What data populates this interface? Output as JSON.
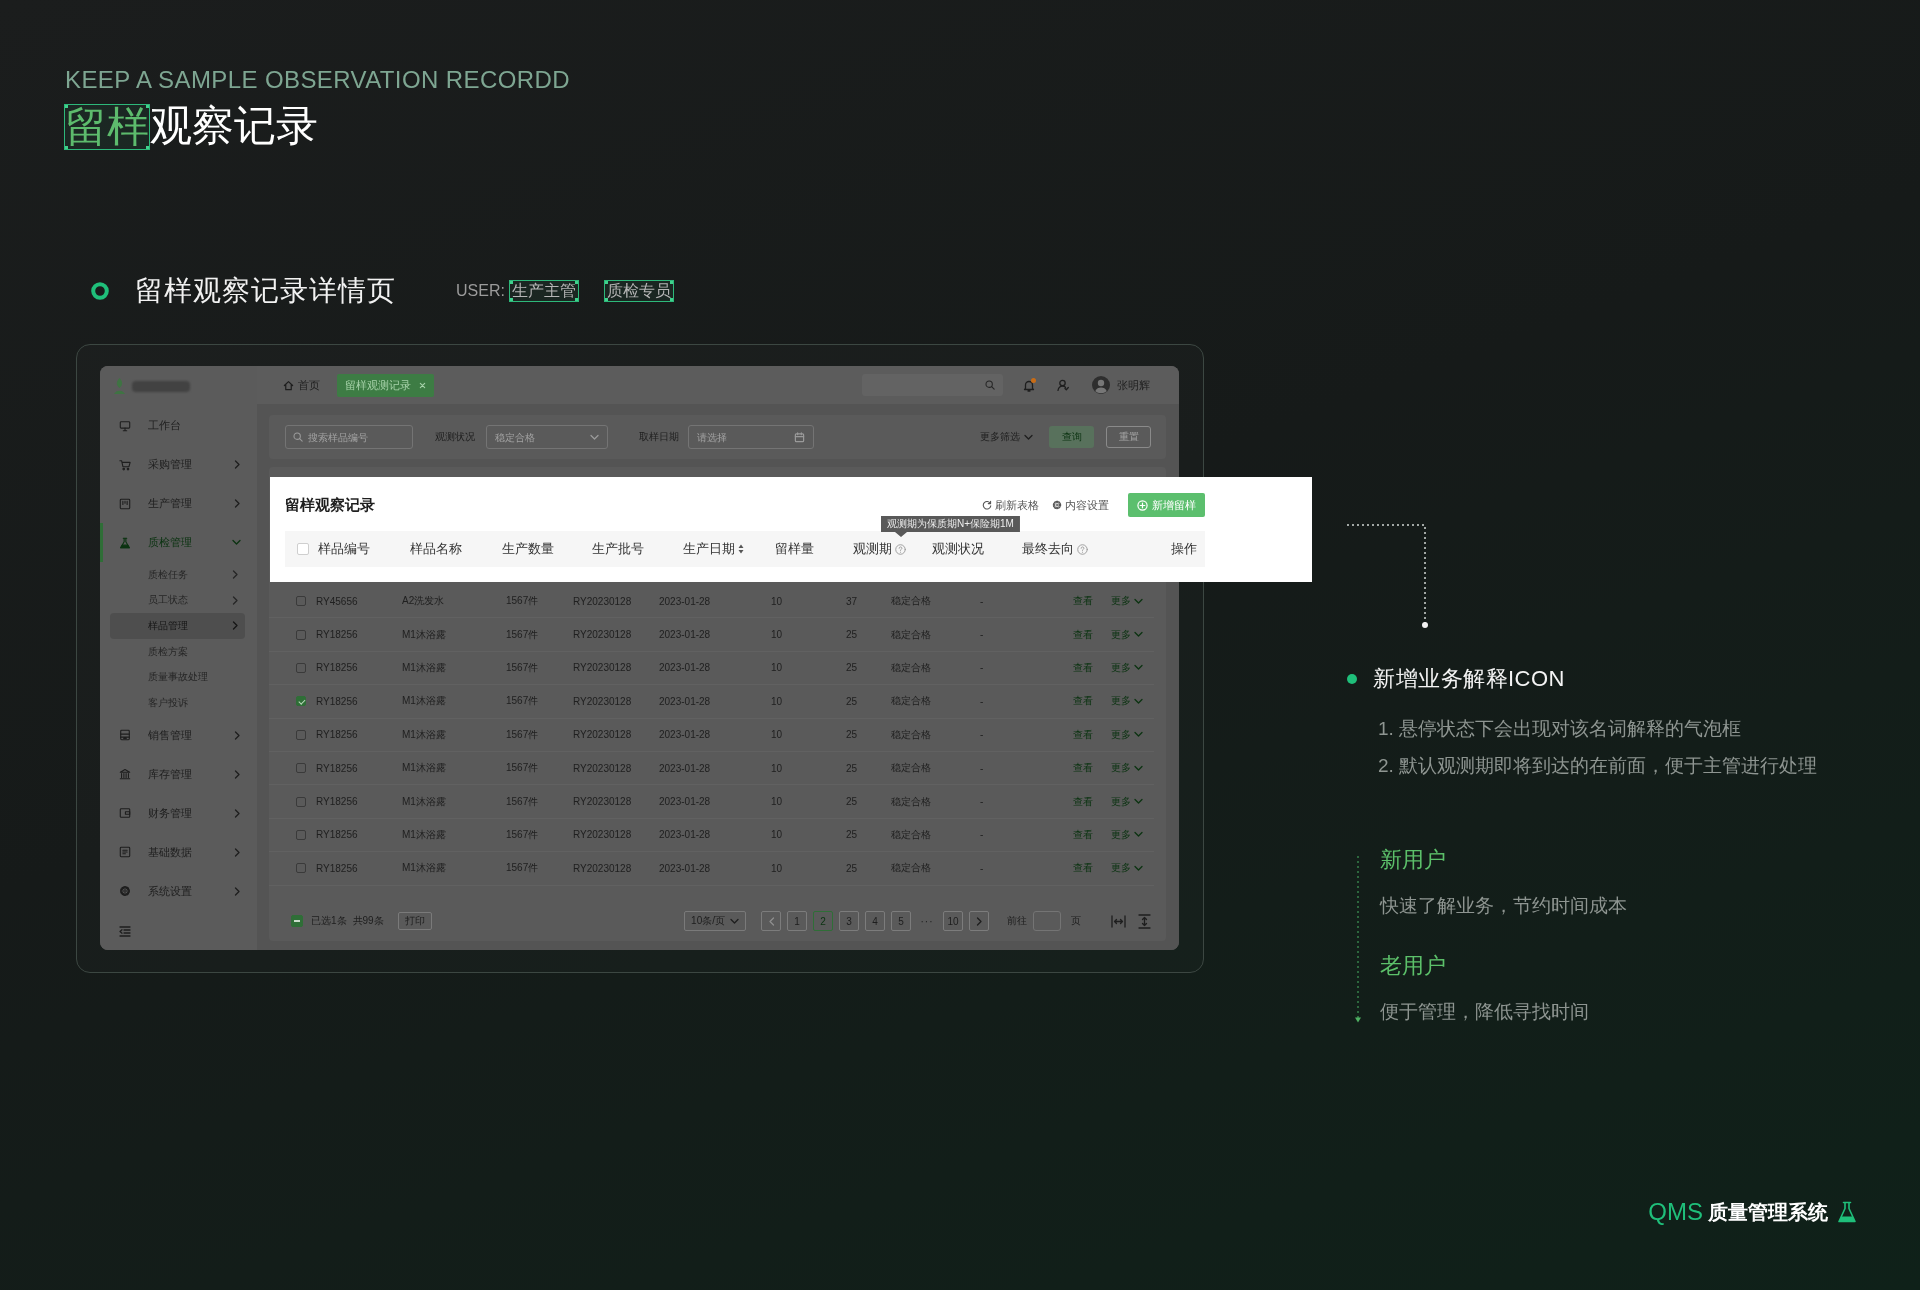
{
  "heading": {
    "subtitle": "KEEP A SAMPLE OBSERVATION RECORDD",
    "title_highlight": "留样",
    "title_rest": "观察记录"
  },
  "section": {
    "title": "留样观察记录详情页",
    "user_label": "USER:",
    "user_roles": [
      "生产主管",
      "质检专员"
    ]
  },
  "app": {
    "sidebar": {
      "items": [
        {
          "kind": "link",
          "label": "工作台",
          "selected": false
        },
        {
          "kind": "group",
          "label": "采购管理",
          "selected": false,
          "expanded": false
        },
        {
          "kind": "group",
          "label": "生产管理",
          "selected": false,
          "expanded": false
        },
        {
          "kind": "group",
          "label": "质检管理",
          "selected": true,
          "expanded": true,
          "children": [
            {
              "kind": "group",
              "label": "质检任务",
              "selected": false,
              "expanded": false
            },
            {
              "kind": "group",
              "label": "员工状态",
              "selected": false,
              "expanded": false
            },
            {
              "kind": "group",
              "label": "样品管理",
              "selected": true,
              "expanded": false
            },
            {
              "kind": "link",
              "label": "质检方案",
              "selected": false
            },
            {
              "kind": "link",
              "label": "质量事故处理",
              "selected": false
            },
            {
              "kind": "link",
              "label": "客户投诉",
              "selected": false
            }
          ]
        },
        {
          "kind": "group",
          "label": "销售管理",
          "selected": false,
          "expanded": false
        },
        {
          "kind": "group",
          "label": "库存管理",
          "selected": false,
          "expanded": false
        },
        {
          "kind": "group",
          "label": "财务管理",
          "selected": false,
          "expanded": false
        },
        {
          "kind": "group",
          "label": "基础数据",
          "selected": false,
          "expanded": false
        },
        {
          "kind": "group",
          "label": "系统设置",
          "selected": false,
          "expanded": false
        }
      ]
    },
    "topbar": {
      "tabs": [
        {
          "kind": "home",
          "label": "首页",
          "selected": false
        },
        {
          "kind": "closable",
          "label": "留样观测记录",
          "selected": true
        }
      ],
      "unread": true,
      "user_name": "张明辉"
    },
    "filters": {
      "search_placeholder": "搜索样品编号",
      "fields": [
        {
          "kind": "select",
          "label": "观测状况",
          "placeholder": "稳定合格"
        },
        {
          "kind": "date",
          "label": "取样日期",
          "placeholder": "请选择"
        }
      ],
      "more_filters": "更多筛选",
      "buttons": [
        {
          "kind": "primary",
          "label": "查询"
        },
        {
          "kind": "outline",
          "label": "重置"
        }
      ]
    },
    "table": {
      "rows": [
        {
          "checked": false,
          "cells": [
            "RY45656",
            "A2洗发水",
            "1567件",
            "RY20230128",
            "2023-01-28",
            "10",
            "37",
            "稳定合格",
            "-"
          ],
          "actions": [
            {
              "kind": "link",
              "label": "查看"
            },
            {
              "kind": "dropdown",
              "label": "更多"
            }
          ]
        },
        {
          "checked": false,
          "cells": [
            "RY18256",
            "M1沐浴露",
            "1567件",
            "RY20230128",
            "2023-01-28",
            "10",
            "25",
            "稳定合格",
            "-"
          ],
          "actions": [
            {
              "kind": "link",
              "label": "查看"
            },
            {
              "kind": "dropdown",
              "label": "更多"
            }
          ]
        },
        {
          "checked": false,
          "cells": [
            "RY18256",
            "M1沐浴露",
            "1567件",
            "RY20230128",
            "2023-01-28",
            "10",
            "25",
            "稳定合格",
            "-"
          ],
          "actions": [
            {
              "kind": "link",
              "label": "查看"
            },
            {
              "kind": "dropdown",
              "label": "更多"
            }
          ]
        },
        {
          "checked": true,
          "cells": [
            "RY18256",
            "M1沐浴露",
            "1567件",
            "RY20230128",
            "2023-01-28",
            "10",
            "25",
            "稳定合格",
            "-"
          ],
          "actions": [
            {
              "kind": "link",
              "label": "查看"
            },
            {
              "kind": "dropdown",
              "label": "更多"
            }
          ]
        },
        {
          "checked": false,
          "cells": [
            "RY18256",
            "M1沐浴露",
            "1567件",
            "RY20230128",
            "2023-01-28",
            "10",
            "25",
            "稳定合格",
            "-"
          ],
          "actions": [
            {
              "kind": "link",
              "label": "查看"
            },
            {
              "kind": "dropdown",
              "label": "更多"
            }
          ]
        },
        {
          "checked": false,
          "cells": [
            "RY18256",
            "M1沐浴露",
            "1567件",
            "RY20230128",
            "2023-01-28",
            "10",
            "25",
            "稳定合格",
            "-"
          ],
          "actions": [
            {
              "kind": "link",
              "label": "查看"
            },
            {
              "kind": "dropdown",
              "label": "更多"
            }
          ]
        },
        {
          "checked": false,
          "cells": [
            "RY18256",
            "M1沐浴露",
            "1567件",
            "RY20230128",
            "2023-01-28",
            "10",
            "25",
            "稳定合格",
            "-"
          ],
          "actions": [
            {
              "kind": "link",
              "label": "查看"
            },
            {
              "kind": "dropdown",
              "label": "更多"
            }
          ]
        },
        {
          "checked": false,
          "cells": [
            "RY18256",
            "M1沐浴露",
            "1567件",
            "RY20230128",
            "2023-01-28",
            "10",
            "25",
            "稳定合格",
            "-"
          ],
          "actions": [
            {
              "kind": "link",
              "label": "查看"
            },
            {
              "kind": "dropdown",
              "label": "更多"
            }
          ]
        },
        {
          "checked": false,
          "cells": [
            "RY18256",
            "M1沐浴露",
            "1567件",
            "RY20230128",
            "2023-01-28",
            "10",
            "25",
            "稳定合格",
            "-"
          ],
          "actions": [
            {
              "kind": "link",
              "label": "查看"
            },
            {
              "kind": "dropdown",
              "label": "更多"
            }
          ]
        }
      ]
    },
    "footer": {
      "indeterminate": true,
      "selection": "已选1条",
      "total": "共99条",
      "print": "打印",
      "page_size": "10条/页",
      "prev_disabled": true,
      "next_disabled": false,
      "pages": [
        {
          "kind": "page",
          "label": "1",
          "selected": false
        },
        {
          "kind": "page",
          "label": "2",
          "selected": true
        },
        {
          "kind": "page",
          "label": "3",
          "selected": false
        },
        {
          "kind": "page",
          "label": "4",
          "selected": false
        },
        {
          "kind": "page",
          "label": "5",
          "selected": false
        },
        {
          "kind": "ellipsis",
          "label": "···",
          "selected": false
        },
        {
          "kind": "page",
          "label": "10",
          "selected": false
        }
      ],
      "goto_label": "前往",
      "goto_unit": "页"
    }
  },
  "callout": {
    "title": "留样观察记录",
    "tools": [
      {
        "kind": "refresh",
        "label": "刷新表格"
      },
      {
        "kind": "settings",
        "label": "内容设置"
      }
    ],
    "add_button": "新增留样",
    "select_all": {
      "checked": false
    },
    "columns": [
      {
        "label": "样品编号",
        "sortable": false,
        "help": false
      },
      {
        "label": "样品名称",
        "sortable": false,
        "help": false
      },
      {
        "label": "生产数量",
        "sortable": false,
        "help": false
      },
      {
        "label": "生产批号",
        "sortable": false,
        "help": false
      },
      {
        "label": "生产日期",
        "sortable": true,
        "help": false
      },
      {
        "label": "留样量",
        "sortable": false,
        "help": false
      },
      {
        "label": "观测期",
        "sortable": false,
        "help": true,
        "tooltip": "观测期为保质期N+保险期1M"
      },
      {
        "label": "观测状况",
        "sortable": false,
        "help": false
      },
      {
        "label": "最终去向",
        "sortable": false,
        "help": true
      },
      {
        "label": "操作",
        "sortable": false,
        "help": false
      }
    ]
  },
  "notes": {
    "title": "新增业务解释ICON",
    "points": [
      "1. 悬停状态下会出现对该名词解释的气泡框",
      "2. 默认观测期即将到达的在前面，便于主管进行处理"
    ]
  },
  "user_groups": [
    {
      "title": "新用户",
      "text": "快速了解业务，节约时间成本"
    },
    {
      "title": "老用户",
      "text": "便于管理，降低寻找时间"
    }
  ],
  "brand": {
    "short": "QMS",
    "name": "质量管理系统"
  }
}
